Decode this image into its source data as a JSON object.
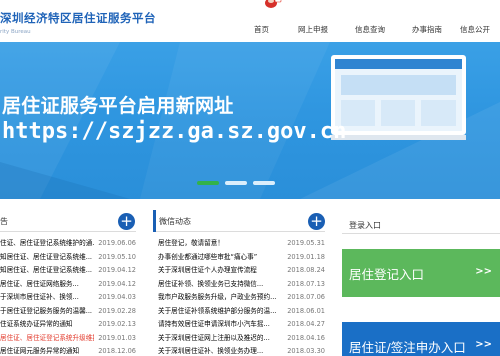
{
  "header": {
    "logo_title": "深圳经济特区居住证服务平台",
    "logo_subtitle": "rity Bureau"
  },
  "nav": {
    "items": [
      {
        "label": "首页"
      },
      {
        "label": "网上申报"
      },
      {
        "label": "信息查询"
      },
      {
        "label": "办事指南"
      },
      {
        "label": "信息公开"
      }
    ]
  },
  "banner": {
    "title": "居住证服务平台启用新网址",
    "url": "https://szjzz.ga.sz.gov.cn"
  },
  "notices": {
    "title": "告",
    "plus": "+",
    "items": [
      {
        "text": "住证、居住证登记系统维护的通...",
        "date": "2019.06.06",
        "highlight": false
      },
      {
        "text": "知居住证、居住证登记系统维...",
        "date": "2019.05.10",
        "highlight": false
      },
      {
        "text": "知居住证、居住证登记系统维...",
        "date": "2019.04.12",
        "highlight": false
      },
      {
        "text": "居住证、居住证网络服务...",
        "date": "2019.04.12",
        "highlight": false
      },
      {
        "text": "于深圳市居住证补、换领...",
        "date": "2019.04.03",
        "highlight": false
      },
      {
        "text": "于居住证登记服务服务的温馨...",
        "date": "2019.02.28",
        "highlight": false
      },
      {
        "text": "住证系统办证异常的通知",
        "date": "2019.02.13",
        "highlight": false
      },
      {
        "text": "居住证、居住证登记系统升级维护...",
        "date": "2019.01.03",
        "highlight": true
      },
      {
        "text": "居住证网元服务异常的通知",
        "date": "2018.12.06",
        "highlight": false
      }
    ]
  },
  "wechat": {
    "title": "微信动态",
    "plus": "+",
    "items": [
      {
        "text": "居住登记，敬请留意！",
        "date": "2019.05.31"
      },
      {
        "text": "办事创业都通过哪些审批“痛心事”",
        "date": "2019.01.18"
      },
      {
        "text": "关于深圳居住证个人办理宣传流程",
        "date": "2018.08.24"
      },
      {
        "text": "居住证补领、换领业务已支持微信...",
        "date": "2018.07.13"
      },
      {
        "text": "我市户政服务服务升级，户政业务预约...",
        "date": "2018.07.06"
      },
      {
        "text": "关于居住证补领系统维护部分服务的温...",
        "date": "2018.06.01"
      },
      {
        "text": "请持有效居住证申请深圳市小汽车摇...",
        "date": "2018.04.27"
      },
      {
        "text": "关于深圳居住证网上注册以及推迟的...",
        "date": "2018.04.16"
      },
      {
        "text": "关于深圳居住证补、换领业务办理...",
        "date": "2018.03.30"
      }
    ]
  },
  "login": {
    "title": "登录入口",
    "buttons": [
      {
        "label": "居住登记入口",
        "arrow": ">>",
        "color": "#5cb85c"
      },
      {
        "label": "居住证/签注申办入口",
        "arrow": ">>",
        "color": "#1a6fc6"
      }
    ]
  },
  "colors": {
    "brand_blue": "#1f63b8",
    "banner_blue": "#2f96e0",
    "accent_green": "#33b24a",
    "highlight_red": "#e23a2c"
  }
}
